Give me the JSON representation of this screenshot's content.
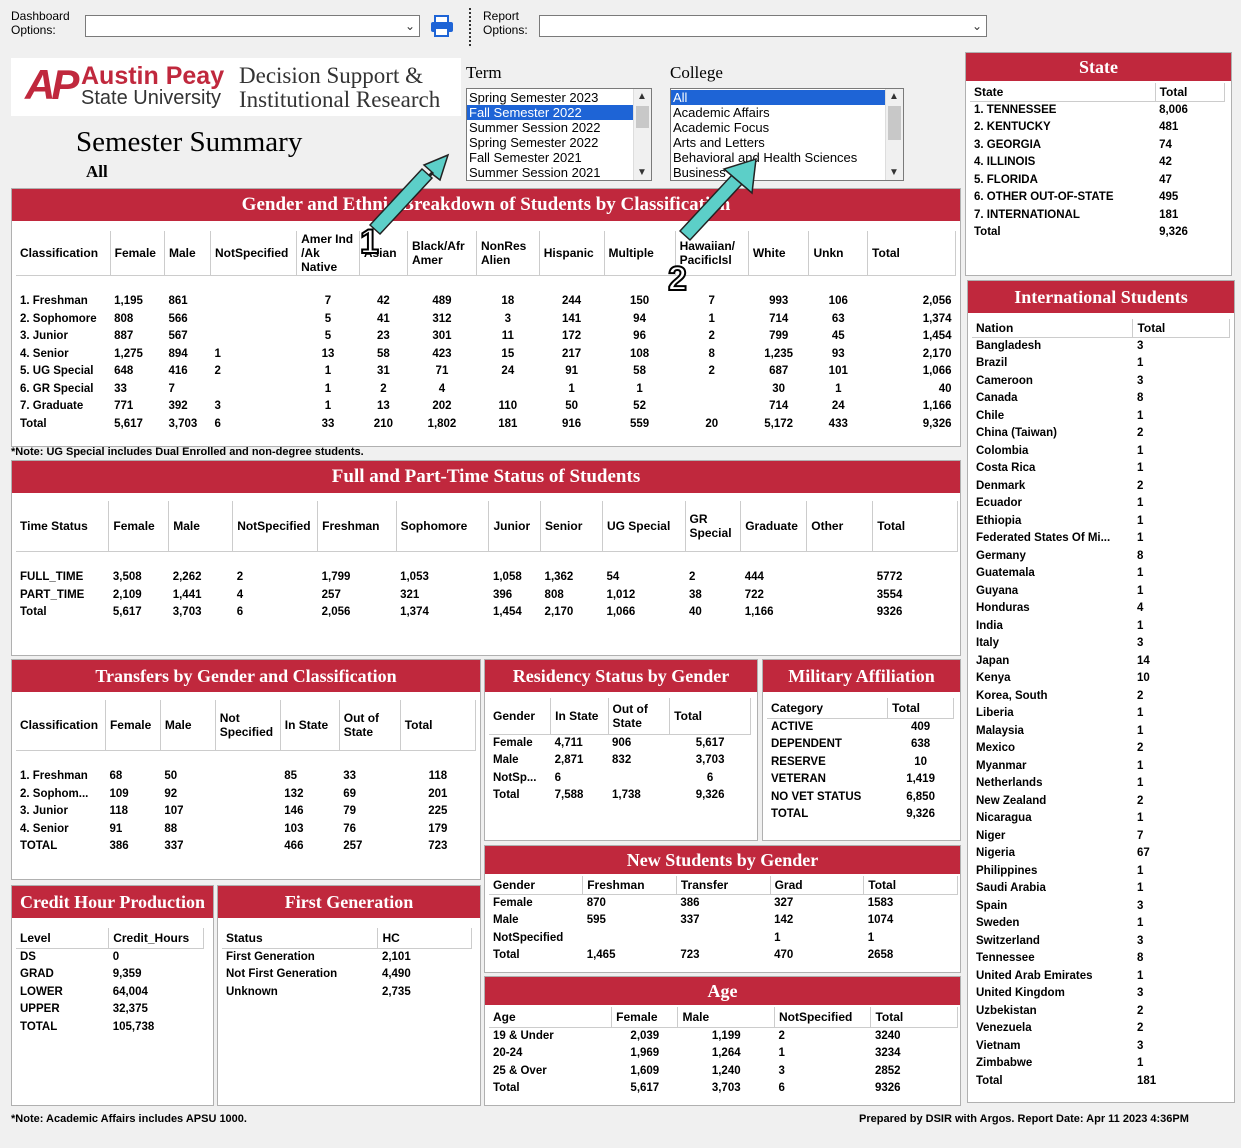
{
  "toolbar": {
    "dash_label_1": "Dashboard",
    "dash_label_2": "Options:",
    "report_label_1": "Report",
    "report_label_2": "Options:"
  },
  "logo": {
    "brand1": "Austin Peay",
    "brand2": "State University",
    "dept1": "Decision Support &",
    "dept2": "Institutional Research"
  },
  "page": {
    "title": "Semester Summary",
    "subtitle": "All"
  },
  "term": {
    "label": "Term",
    "items": [
      "Spring Semester 2023",
      "Fall Semester 2022",
      "Summer Session 2022",
      "Spring Semester 2022",
      "Fall Semester 2021",
      "Summer Session 2021"
    ],
    "selected": 1
  },
  "college": {
    "label": "College",
    "items": [
      "All",
      "Academic Affairs",
      "Academic Focus",
      "Arts and Letters",
      "Behavioral and Health Sciences",
      "Business"
    ],
    "selected": 0
  },
  "annotations": {
    "a1": "1",
    "a2": "2"
  },
  "gender_ethnic": {
    "title": "Gender and Ethnic Breakdown of Students by Classification",
    "headers": [
      "Classification",
      "Female",
      "Male",
      "NotSpecified",
      "Amer Ind /Ak Native",
      "Asian",
      "Black/Afr Amer",
      "NonRes Alien",
      "Hispanic",
      "Multiple",
      "Hawaiian/ PacificIsl",
      "White",
      "Unkn",
      "Total"
    ],
    "rows": [
      [
        "1. Freshman",
        "1,195",
        "861",
        "",
        "7",
        "42",
        "489",
        "18",
        "244",
        "150",
        "7",
        "993",
        "106",
        "2,056"
      ],
      [
        "2. Sophomore",
        "808",
        "566",
        "",
        "5",
        "41",
        "312",
        "3",
        "141",
        "94",
        "1",
        "714",
        "63",
        "1,374"
      ],
      [
        "3. Junior",
        "887",
        "567",
        "",
        "5",
        "23",
        "301",
        "11",
        "172",
        "96",
        "2",
        "799",
        "45",
        "1,454"
      ],
      [
        "4. Senior",
        "1,275",
        "894",
        "1",
        "13",
        "58",
        "423",
        "15",
        "217",
        "108",
        "8",
        "1,235",
        "93",
        "2,170"
      ],
      [
        "5. UG Special",
        "648",
        "416",
        "2",
        "1",
        "31",
        "71",
        "24",
        "91",
        "58",
        "2",
        "687",
        "101",
        "1,066"
      ],
      [
        "6. GR Special",
        "33",
        "7",
        "",
        "1",
        "2",
        "4",
        "",
        "1",
        "1",
        "",
        "30",
        "1",
        "40"
      ],
      [
        "7. Graduate",
        "771",
        "392",
        "3",
        "1",
        "13",
        "202",
        "110",
        "50",
        "52",
        "",
        "714",
        "24",
        "1,166"
      ],
      [
        "Total",
        "5,617",
        "3,703",
        "6",
        "33",
        "210",
        "1,802",
        "181",
        "916",
        "559",
        "20",
        "5,172",
        "433",
        "9,326"
      ]
    ],
    "note": "*Note: UG Special includes Dual Enrolled and non-degree students."
  },
  "time_status": {
    "title": "Full and Part-Time Status of Students",
    "headers": [
      "Time Status",
      "Female",
      "Male",
      "NotSpecified",
      "Freshman",
      "Sophomore",
      "Junior",
      "Senior",
      "UG Special",
      "GR Special",
      "Graduate",
      "Other",
      "Total"
    ],
    "rows": [
      [
        "FULL_TIME",
        "3,508",
        "2,262",
        "2",
        "1,799",
        "1,053",
        "1,058",
        "1,362",
        "54",
        "2",
        "444",
        "",
        "5772"
      ],
      [
        "PART_TIME",
        "2,109",
        "1,441",
        "4",
        "257",
        "321",
        "396",
        "808",
        "1,012",
        "38",
        "722",
        "",
        "3554"
      ],
      [
        "Total",
        "5,617",
        "3,703",
        "6",
        "2,056",
        "1,374",
        "1,454",
        "2,170",
        "1,066",
        "40",
        "1,166",
        "",
        "9326"
      ]
    ]
  },
  "transfers": {
    "title": "Transfers by Gender and Classification",
    "headers": [
      "Classification",
      "Female",
      "Male",
      "Not Specified",
      "In State",
      "Out of State",
      "Total"
    ],
    "rows": [
      [
        "1. Freshman",
        "68",
        "50",
        "",
        "85",
        "33",
        "118"
      ],
      [
        "2. Sophom...",
        "109",
        "92",
        "",
        "132",
        "69",
        "201"
      ],
      [
        "3. Junior",
        "118",
        "107",
        "",
        "146",
        "79",
        "225"
      ],
      [
        "4. Senior",
        "91",
        "88",
        "",
        "103",
        "76",
        "179"
      ],
      [
        "TOTAL",
        "386",
        "337",
        "",
        "466",
        "257",
        "723"
      ]
    ]
  },
  "residency": {
    "title": "Residency Status by Gender",
    "headers": [
      "Gender",
      "In State",
      "Out of State",
      "Total"
    ],
    "rows": [
      [
        "Female",
        "4,711",
        "906",
        "5,617"
      ],
      [
        "Male",
        "2,871",
        "832",
        "3,703"
      ],
      [
        "NotSp...",
        "6",
        "",
        "6"
      ],
      [
        "Total",
        "7,588",
        "1,738",
        "9,326"
      ]
    ]
  },
  "military": {
    "title": "Military Affiliation",
    "headers": [
      "Category",
      "Total"
    ],
    "rows": [
      [
        "ACTIVE",
        "409"
      ],
      [
        "DEPENDENT",
        "638"
      ],
      [
        "RESERVE",
        "10"
      ],
      [
        "VETERAN",
        "1,419"
      ],
      [
        "NO VET STATUS",
        "6,850"
      ],
      [
        "TOTAL",
        "9,326"
      ]
    ]
  },
  "new_students": {
    "title": "New Students by Gender",
    "headers": [
      "Gender",
      "Freshman",
      "Transfer",
      "Grad",
      "Total"
    ],
    "rows": [
      [
        "Female",
        "870",
        "386",
        "327",
        "1583"
      ],
      [
        "Male",
        "595",
        "337",
        "142",
        "1074"
      ],
      [
        "NotSpecified",
        "",
        "",
        "1",
        "1"
      ],
      [
        "Total",
        "1,465",
        "723",
        "470",
        "2658"
      ]
    ]
  },
  "age": {
    "title": "Age",
    "headers": [
      "Age",
      "Female",
      "Male",
      "NotSpecified",
      "Total"
    ],
    "rows": [
      [
        "19 & Under",
        "2,039",
        "1,199",
        "2",
        "3240"
      ],
      [
        "20-24",
        "1,969",
        "1,264",
        "1",
        "3234"
      ],
      [
        "25 & Over",
        "1,609",
        "1,240",
        "3",
        "2852"
      ],
      [
        "Total",
        "5,617",
        "3,703",
        "6",
        "9326"
      ]
    ]
  },
  "credit": {
    "title": "Credit Hour Production",
    "headers": [
      "Level",
      "Credit_Hours"
    ],
    "rows": [
      [
        "DS",
        "0"
      ],
      [
        "GRAD",
        "9,359"
      ],
      [
        "LOWER",
        "64,004"
      ],
      [
        "UPPER",
        "32,375"
      ],
      [
        "TOTAL",
        "105,738"
      ]
    ]
  },
  "firstgen": {
    "title": "First Generation",
    "headers": [
      "Status",
      "HC"
    ],
    "rows": [
      [
        "First Generation",
        "2,101"
      ],
      [
        "Not First Generation",
        "4,490"
      ],
      [
        "Unknown",
        "2,735"
      ]
    ]
  },
  "state": {
    "title": "State",
    "headers": [
      "State",
      "Total"
    ],
    "rows": [
      [
        "1. TENNESSEE",
        "8,006"
      ],
      [
        "2. KENTUCKY",
        "481"
      ],
      [
        "3. GEORGIA",
        "74"
      ],
      [
        "4. ILLINOIS",
        "42"
      ],
      [
        "5. FLORIDA",
        "47"
      ],
      [
        "6. OTHER OUT-OF-STATE",
        "495"
      ],
      [
        "7. INTERNATIONAL",
        "181"
      ],
      [
        "Total",
        "9,326"
      ]
    ]
  },
  "international": {
    "title": "International Students",
    "headers": [
      "Nation",
      "Total"
    ],
    "rows": [
      [
        "Bangladesh",
        "3"
      ],
      [
        "Brazil",
        "1"
      ],
      [
        "Cameroon",
        "3"
      ],
      [
        "Canada",
        "8"
      ],
      [
        "Chile",
        "1"
      ],
      [
        "China (Taiwan)",
        "2"
      ],
      [
        "Colombia",
        "1"
      ],
      [
        "Costa Rica",
        "1"
      ],
      [
        "Denmark",
        "2"
      ],
      [
        "Ecuador",
        "1"
      ],
      [
        "Ethiopia",
        "1"
      ],
      [
        "Federated States Of Mi...",
        "1"
      ],
      [
        "Germany",
        "8"
      ],
      [
        "Guatemala",
        "1"
      ],
      [
        "Guyana",
        "1"
      ],
      [
        "Honduras",
        "4"
      ],
      [
        "India",
        "1"
      ],
      [
        "Italy",
        "3"
      ],
      [
        "Japan",
        "14"
      ],
      [
        "Kenya",
        "10"
      ],
      [
        "Korea, South",
        "2"
      ],
      [
        "Liberia",
        "1"
      ],
      [
        "Malaysia",
        "1"
      ],
      [
        "Mexico",
        "2"
      ],
      [
        "Myanmar",
        "1"
      ],
      [
        "Netherlands",
        "1"
      ],
      [
        "New Zealand",
        "2"
      ],
      [
        "Nicaragua",
        "1"
      ],
      [
        "Niger",
        "7"
      ],
      [
        "Nigeria",
        "67"
      ],
      [
        "Philippines",
        "1"
      ],
      [
        "Saudi Arabia",
        "1"
      ],
      [
        "Spain",
        "3"
      ],
      [
        "Sweden",
        "1"
      ],
      [
        "Switzerland",
        "3"
      ],
      [
        "Tennessee",
        "8"
      ],
      [
        "United Arab Emirates",
        "1"
      ],
      [
        "United Kingdom",
        "3"
      ],
      [
        "Uzbekistan",
        "2"
      ],
      [
        "Venezuela",
        "2"
      ],
      [
        "Vietnam",
        "3"
      ],
      [
        "Zimbabwe",
        "1"
      ],
      [
        "Total",
        "181"
      ]
    ]
  },
  "footer": {
    "left": "*Note: Academic Affairs includes APSU 1000.",
    "right": "Prepared by DSIR with Argos. Report Date: Apr 11 2023  4:36PM"
  }
}
